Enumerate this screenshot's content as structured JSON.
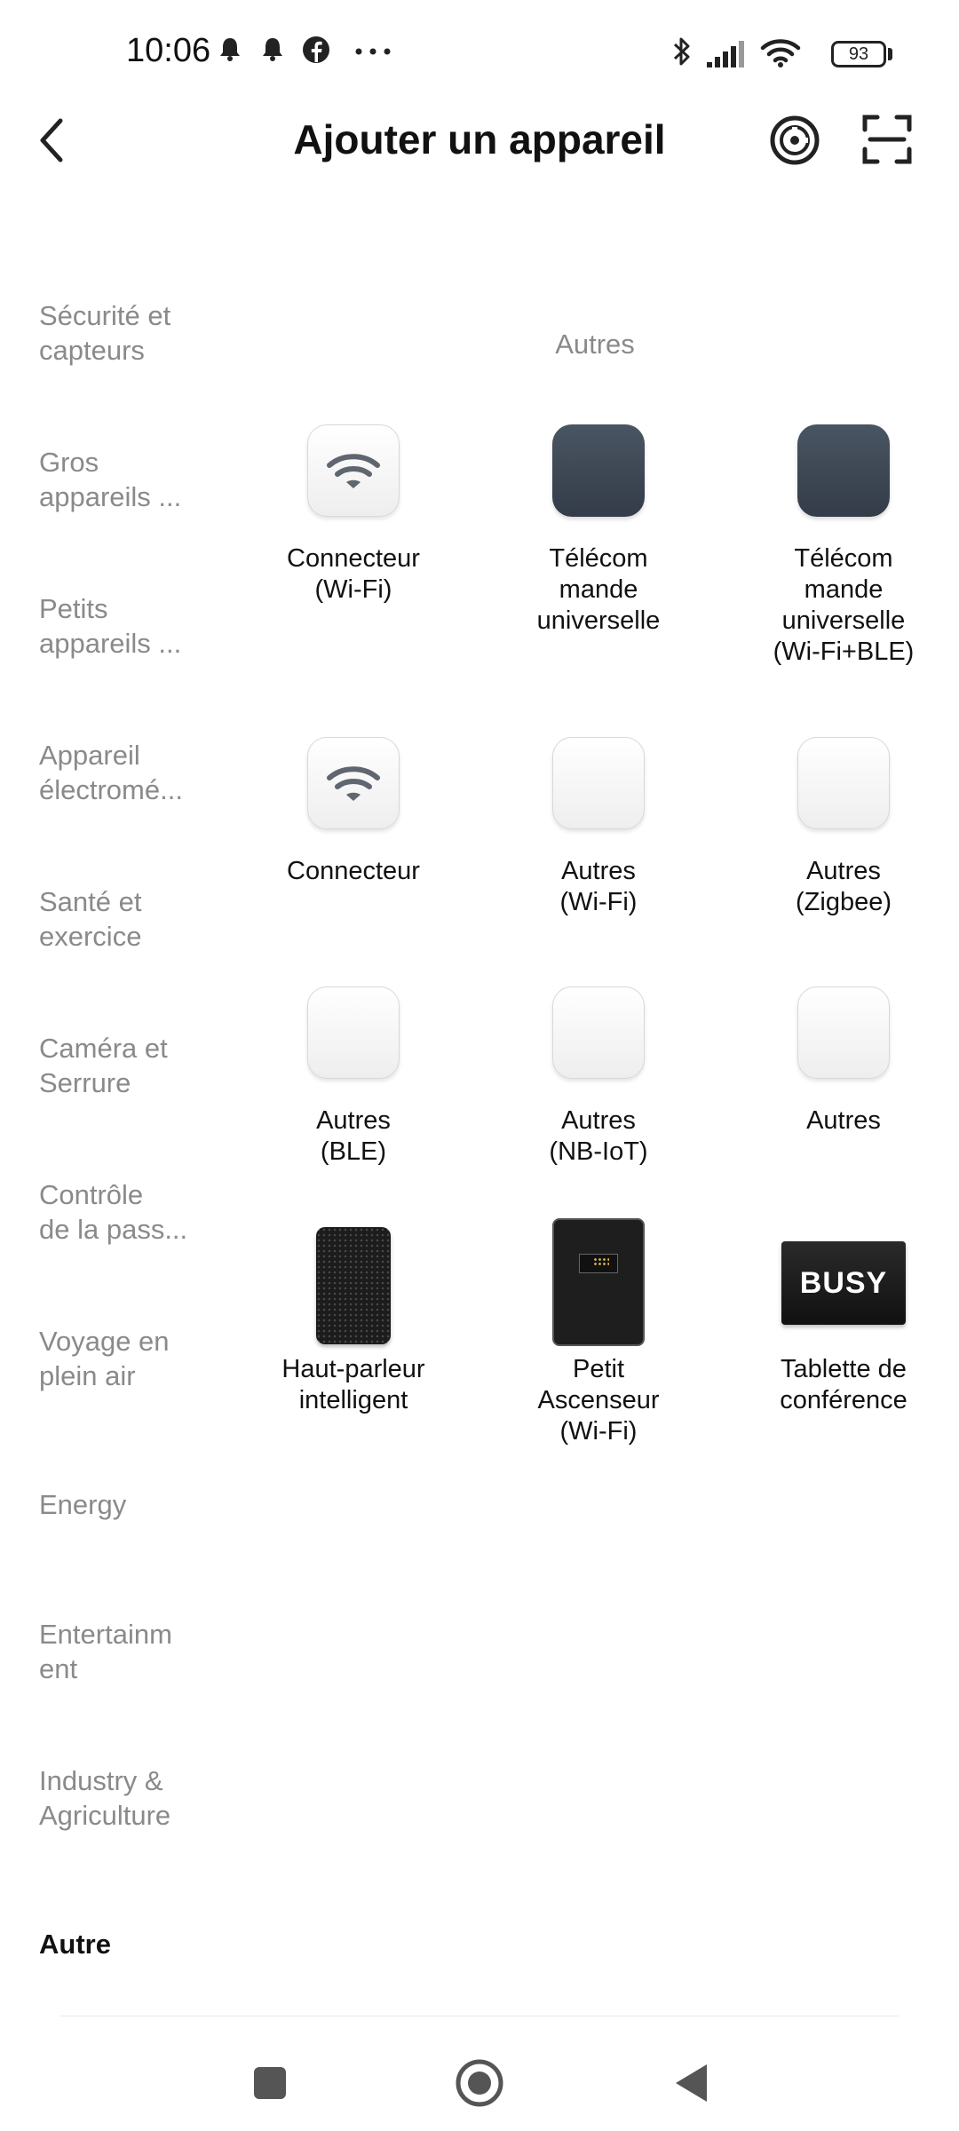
{
  "status_bar": {
    "time": "10:06",
    "battery": "93"
  },
  "header": {
    "title": "Ajouter un appareil"
  },
  "sidebar": {
    "items": [
      {
        "label": "Sécurité et\ncapteurs"
      },
      {
        "label": "Gros\nappareils ..."
      },
      {
        "label": "Petits\nappareils ..."
      },
      {
        "label": "Appareil\nélectromé..."
      },
      {
        "label": "Santé et\nexercice"
      },
      {
        "label": "Caméra et\nSerrure"
      },
      {
        "label": "Contrôle\nde la pass..."
      },
      {
        "label": "Voyage en\nplein air"
      },
      {
        "label": "Energy"
      },
      {
        "label": "Entertainm\nent"
      },
      {
        "label": "Industry &\nAgriculture"
      },
      {
        "label": "Autre"
      }
    ],
    "active_label": "Autre"
  },
  "section": {
    "title": "Autres"
  },
  "devices": [
    {
      "label": "Connecteur\n(Wi-Fi)",
      "icon": "wifi-connector-icon"
    },
    {
      "label": "Télécom\nmande\nuniverselle",
      "icon": "remote-icon"
    },
    {
      "label": "Télécom\nmande\nuniverselle\n(Wi-Fi+BLE)",
      "icon": "remote-icon"
    },
    {
      "label": "Connecteur",
      "icon": "wifi-connector-icon"
    },
    {
      "label": "Autres\n(Wi-Fi)",
      "icon": "blank-device-icon"
    },
    {
      "label": "Autres\n(Zigbee)",
      "icon": "blank-device-icon"
    },
    {
      "label": "Autres\n(BLE)",
      "icon": "blank-device-icon"
    },
    {
      "label": "Autres\n(NB-IoT)",
      "icon": "blank-device-icon"
    },
    {
      "label": "Autres",
      "icon": "blank-device-icon"
    },
    {
      "label": "Haut-parleur\nintelligent",
      "icon": "smart-speaker-icon"
    },
    {
      "label": "Petit\nAscenseur\n(Wi-Fi)",
      "icon": "elevator-icon"
    },
    {
      "label": "Tablette de\nconférence",
      "icon": "busy-tablet-icon",
      "badge_text": "BUSY"
    }
  ],
  "colors": {
    "tile_dark": "#3a4350",
    "text_muted": "#8a8a8a"
  }
}
